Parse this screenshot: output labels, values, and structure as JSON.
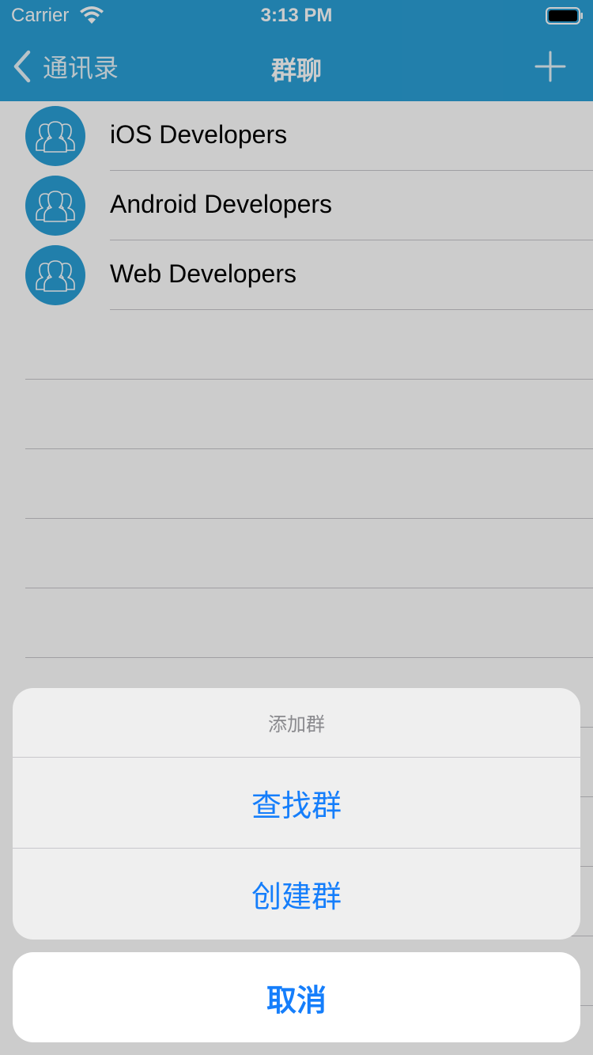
{
  "status_bar": {
    "carrier": "Carrier",
    "time": "3:13 PM"
  },
  "nav": {
    "back_label": "通讯录",
    "title": "群聊",
    "add_icon": "plus-icon"
  },
  "groups": [
    {
      "name": "iOS Developers",
      "icon": "group-icon"
    },
    {
      "name": "Android Developers",
      "icon": "group-icon"
    },
    {
      "name": "Web Developers",
      "icon": "group-icon"
    }
  ],
  "action_sheet": {
    "title": "添加群",
    "actions": [
      {
        "label": "查找群"
      },
      {
        "label": "创建群"
      }
    ],
    "cancel_label": "取消"
  },
  "colors": {
    "nav_background": "#2a9fd6",
    "action_text": "#157efb",
    "sheet_background": "#efefef"
  }
}
